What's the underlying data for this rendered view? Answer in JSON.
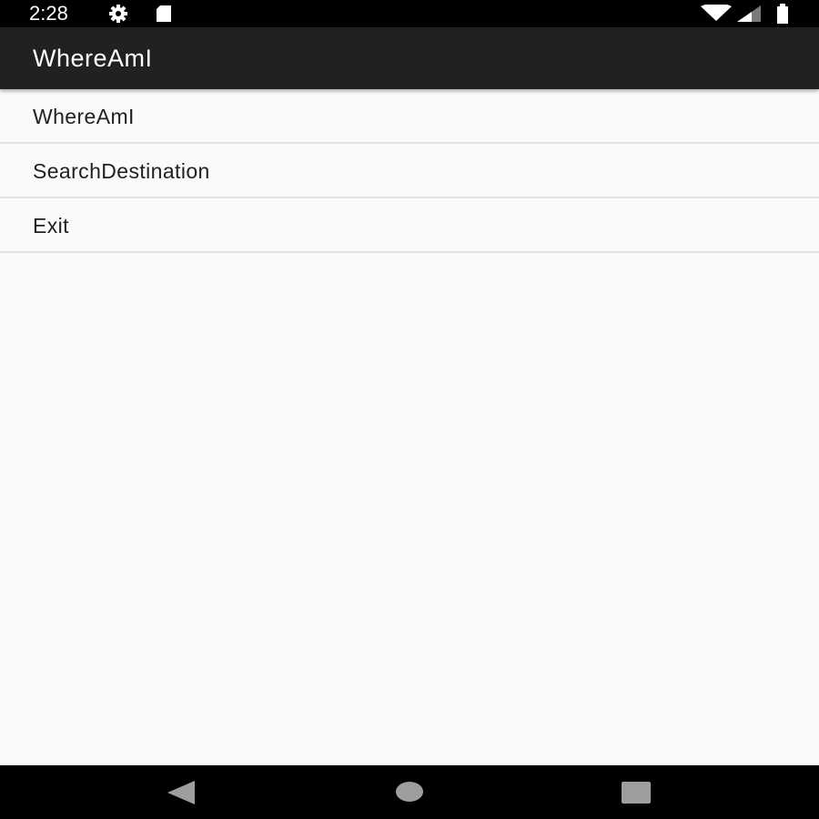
{
  "status_bar": {
    "time": "2:28",
    "icons": [
      "gear-icon",
      "sd-card-icon",
      "wifi-icon",
      "signal-icon",
      "battery-icon"
    ]
  },
  "action_bar": {
    "title": "WhereAmI"
  },
  "menu": {
    "items": [
      {
        "label": "WhereAmI"
      },
      {
        "label": "SearchDestination"
      },
      {
        "label": "Exit"
      }
    ]
  },
  "nav_bar": {
    "buttons": [
      "back-icon",
      "home-icon",
      "recents-icon"
    ]
  },
  "colors": {
    "status_bar_bg": "#000000",
    "action_bar_bg": "#212121",
    "background": "#fafafa",
    "divider": "#e2e2e2",
    "text_primary": "#212121",
    "nav_icons": "#9e9e9e"
  }
}
